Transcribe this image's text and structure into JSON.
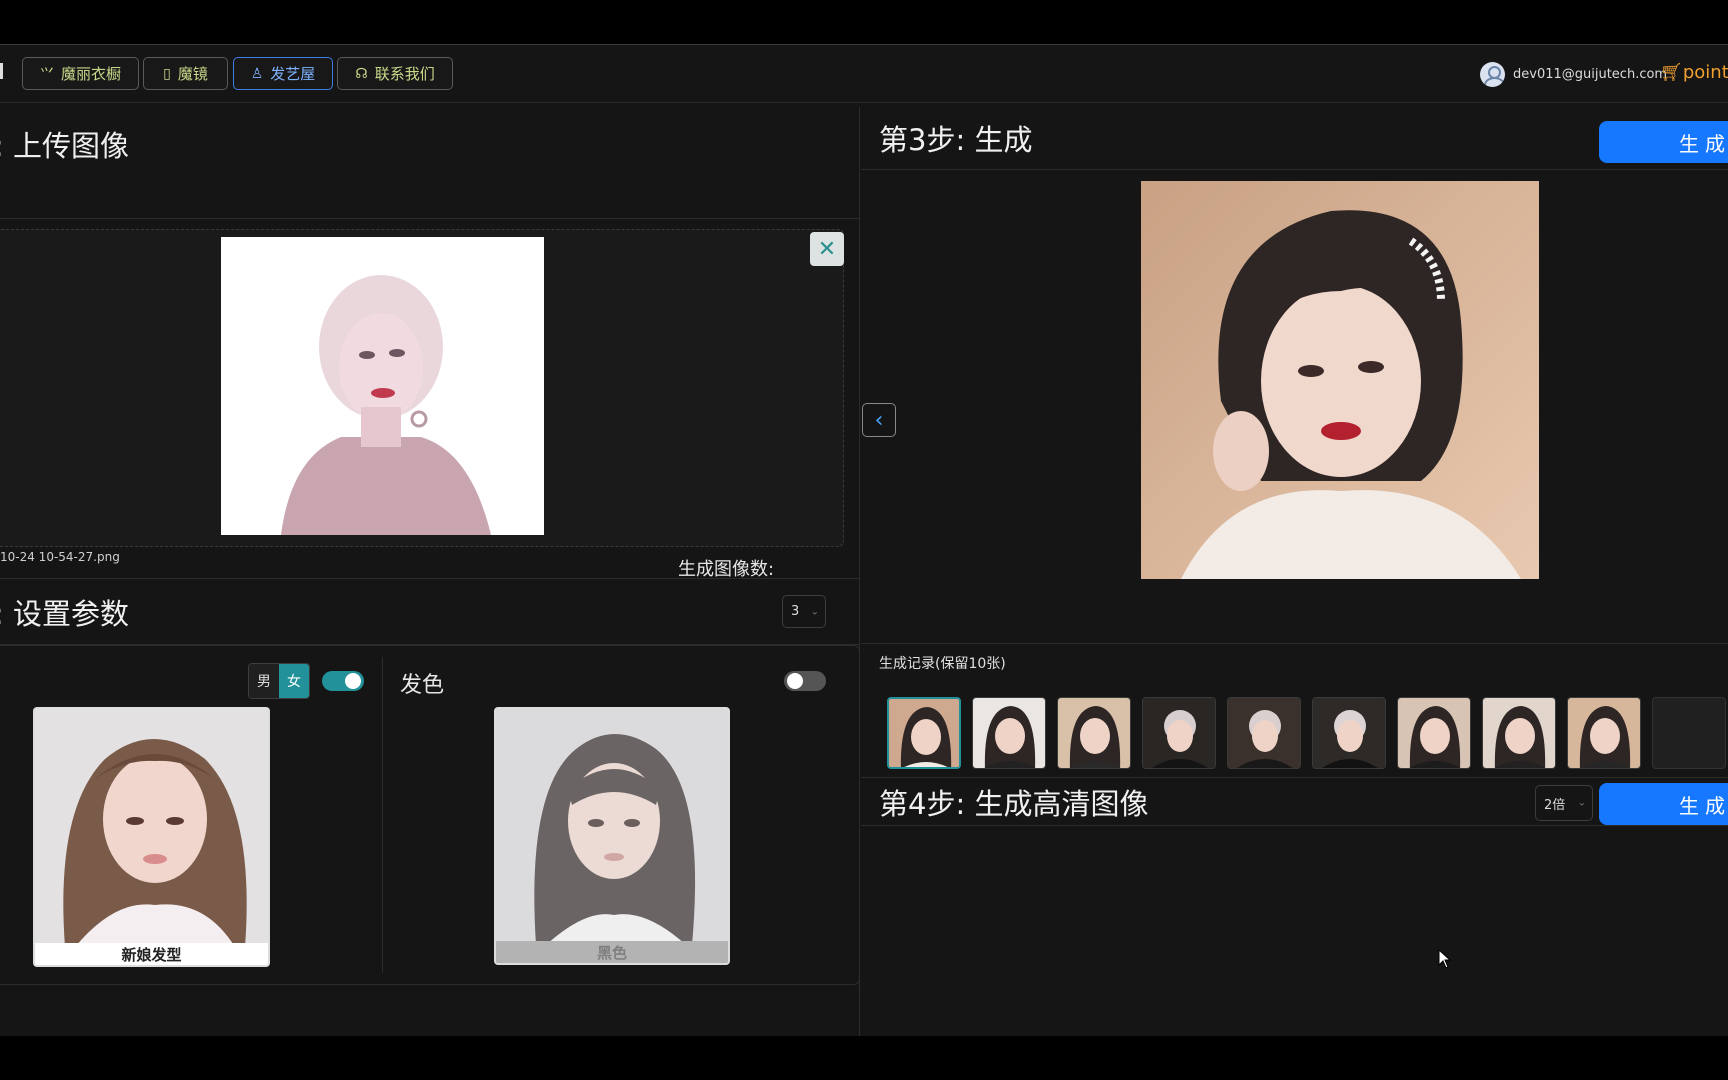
{
  "topbar": {
    "nav": [
      {
        "label": "魔丽衣橱",
        "icon": "hanger-icon"
      },
      {
        "label": "魔镜",
        "icon": "mirror-icon"
      },
      {
        "label": "发艺屋",
        "icon": "person-icon",
        "active": true
      },
      {
        "label": "联系我们",
        "icon": "headset-icon"
      }
    ],
    "user_email": "dev011@guijutech.com",
    "points_label": "point:"
  },
  "step1": {
    "title": ": 上传图像",
    "filename": "10-24 10-54-27.png",
    "close_glyph": "✕"
  },
  "step2": {
    "title": ": 设置参数",
    "count_label": "生成图像数:",
    "count_value": "3",
    "gender": {
      "male": "男",
      "female": "女",
      "selected": "女"
    },
    "hairstyle_toggle": true,
    "hairstyle_card": "新娘发型",
    "color_label": "发色",
    "color_toggle": false,
    "color_card": "黑色"
  },
  "step3": {
    "title": "第3步: 生成",
    "generate_label": "生成",
    "history_label": "生成记录(保留10张)",
    "history_count": 10,
    "selected_index": 0
  },
  "step4": {
    "title": "第4步: 生成高清图像",
    "scale_value": "2倍",
    "generate_label": "生成"
  },
  "colors": {
    "accent_blue": "#1677ff",
    "teal": "#22919a",
    "points_orange": "#f0a030",
    "nav_text": "#c8d98a"
  }
}
